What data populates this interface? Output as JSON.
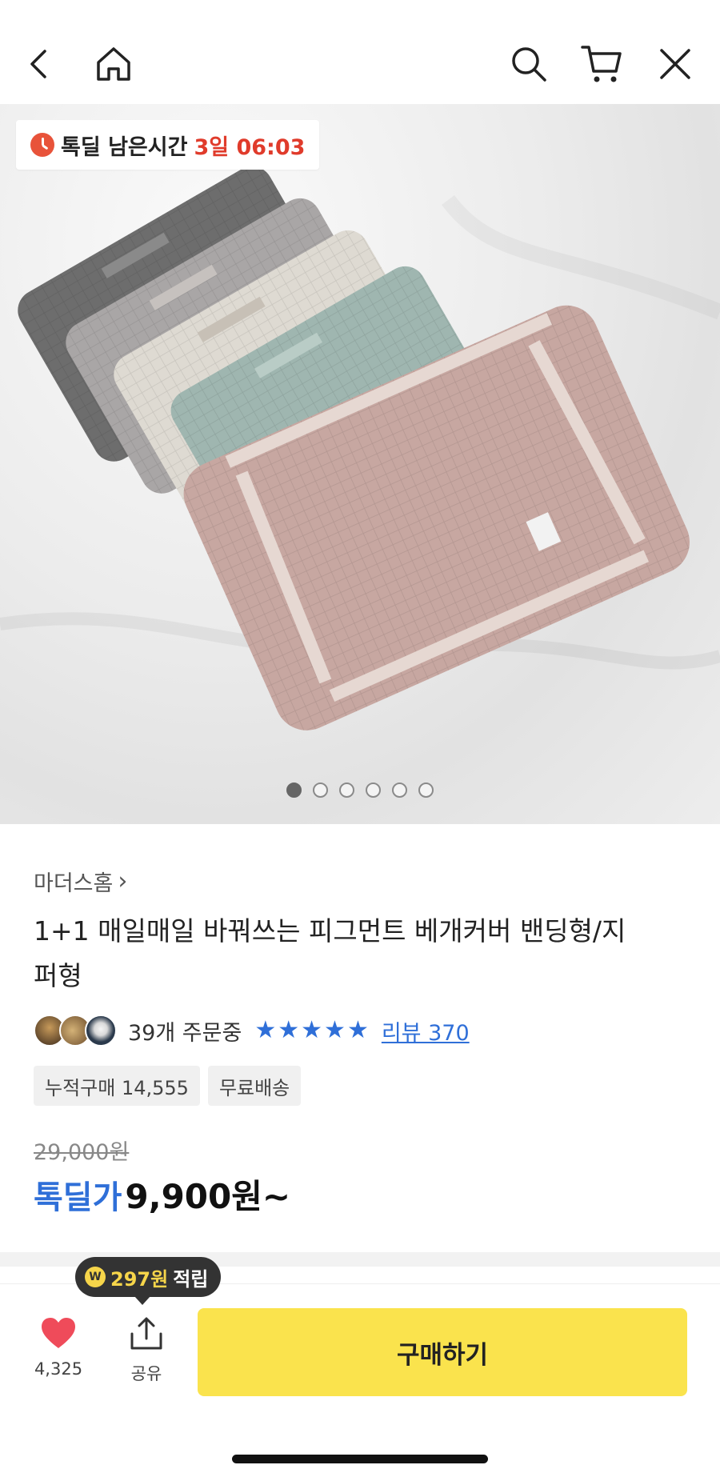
{
  "timer": {
    "label": "톡딜 남은시간",
    "time": "3일 06:03"
  },
  "carousel": {
    "total_pages": 6,
    "current_page": 1
  },
  "product": {
    "brand": "마더스홈",
    "brand_chevron": "›",
    "title": "1+1 매일매일 바꿔쓰는 피그먼트 베개커버 밴딩형/지퍼형",
    "order_count": "39개 주문중",
    "rating_stars": 5,
    "review_link": "리뷰 370",
    "tags": [
      "누적구매 14,555",
      "무료배송"
    ],
    "original_price": "29,000원",
    "deal_label": "톡딜가",
    "deal_price": "9,900원~"
  },
  "bottom": {
    "points_coin": "W",
    "points_amount": "297원",
    "points_earn": "적립",
    "like_count": "4,325",
    "share_label": "공유",
    "buy_label": "구매하기"
  },
  "colors": {
    "accent_blue": "#2f6fd8",
    "timer_red": "#e03b2b",
    "buy_yellow": "#fae34d",
    "heart_red": "#ef4b5a"
  },
  "icons": [
    "back-icon",
    "home-icon",
    "search-icon",
    "cart-icon",
    "close-icon",
    "clock-icon",
    "heart-icon",
    "share-icon",
    "star-icon",
    "chevron-right-icon"
  ]
}
